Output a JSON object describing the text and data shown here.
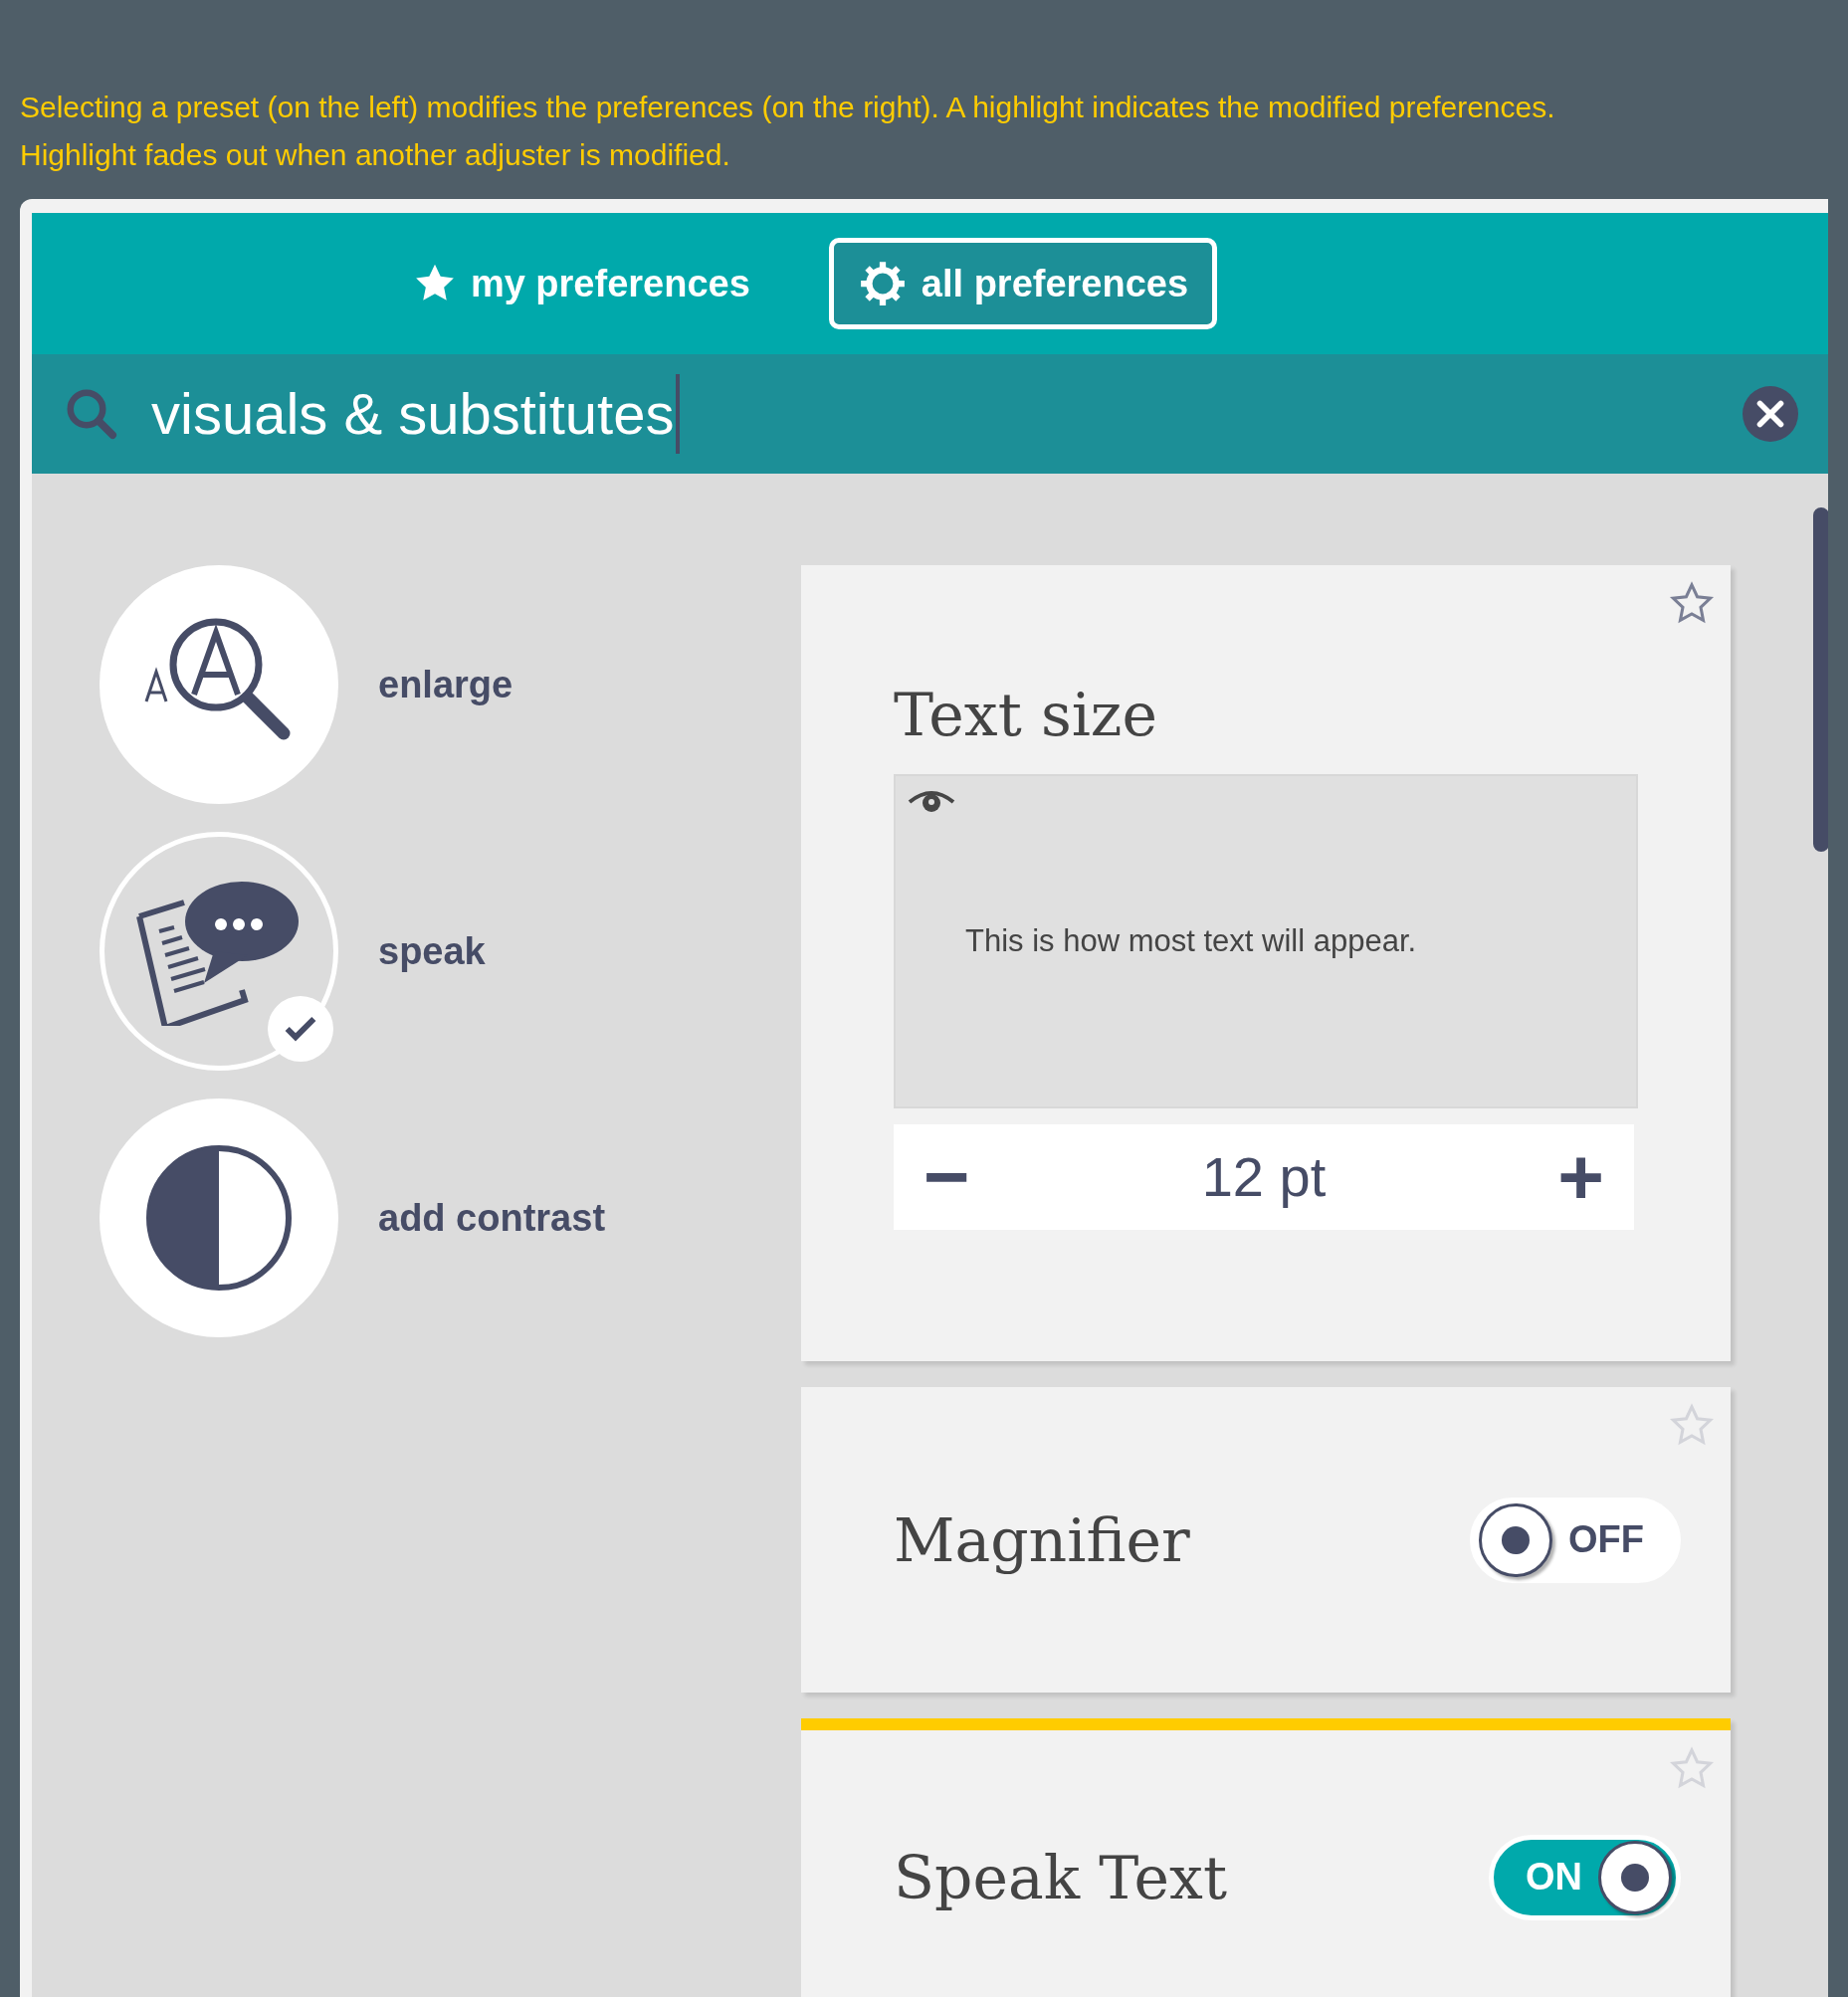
{
  "note": [
    "Selecting a preset (on the left) modifies the preferences (on the right). A highlight indicates the modified preferences.",
    "Highlight fades out when another adjuster is modified."
  ],
  "tabs": [
    {
      "label": "my preferences",
      "kind": "star",
      "selected": false
    },
    {
      "label": "all preferences",
      "kind": "gear",
      "selected": true
    }
  ],
  "search": {
    "value": "visuals & substitutes"
  },
  "presets": [
    {
      "label": "enlarge",
      "kind": "enlarge",
      "selected": false
    },
    {
      "label": "speak",
      "kind": "speak",
      "selected": true
    },
    {
      "label": "add contrast",
      "kind": "contrast",
      "selected": false
    }
  ],
  "adjusters": [
    {
      "kind": "stepper",
      "title": "Text size",
      "highlighted": false,
      "preview": "This is how most text will appear.",
      "value": "12 pt",
      "minus": "−",
      "plus": "+"
    },
    {
      "kind": "toggle",
      "title": "Magnifier",
      "highlighted": false,
      "on": false,
      "state_label": "OFF"
    },
    {
      "kind": "toggle",
      "title": "Speak Text",
      "highlighted": true,
      "on": true,
      "state_label": "ON"
    }
  ]
}
